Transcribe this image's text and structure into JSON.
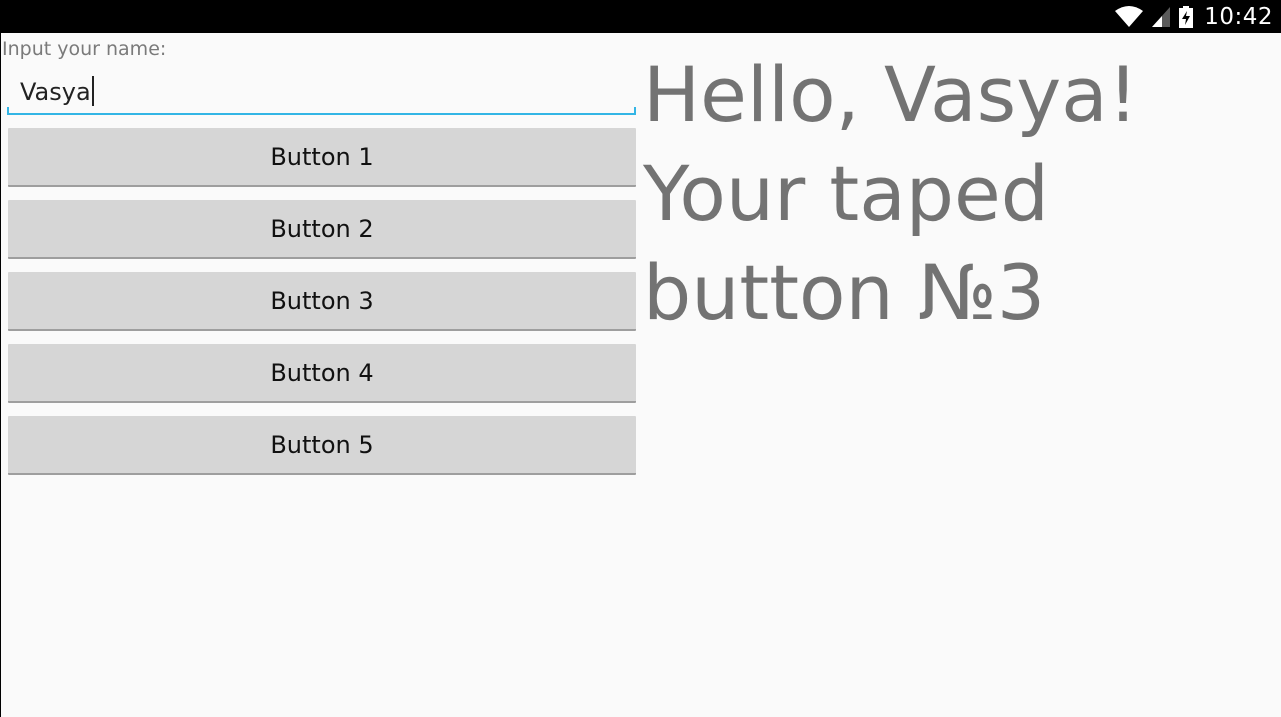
{
  "status_bar": {
    "time": "10:42",
    "icons": [
      "wifi-icon",
      "signal-icon",
      "battery-charging-icon"
    ]
  },
  "form": {
    "label": "Input your name:",
    "name_value": "Vasya"
  },
  "buttons": [
    {
      "label": "Button 1"
    },
    {
      "label": "Button 2"
    },
    {
      "label": "Button 3"
    },
    {
      "label": "Button 4"
    },
    {
      "label": "Button 5"
    }
  ],
  "output": {
    "greeting": "Hello, Vasya! Your taped button №3"
  },
  "colors": {
    "accent": "#33b5e5",
    "button_bg": "#d6d6d6",
    "text_muted": "#737373"
  }
}
